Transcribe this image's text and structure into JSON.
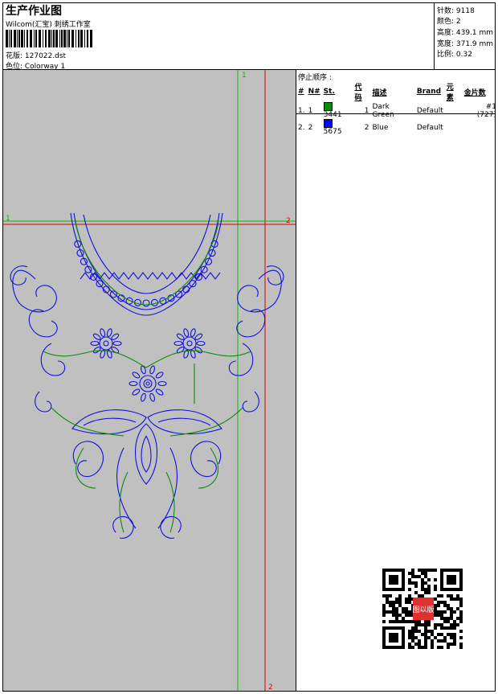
{
  "header": {
    "title": "生产作业图",
    "subtitle": "Wilcom(汇宝) 刺绣工作室",
    "file_label": "花版: 127022.dst",
    "colorway_label": "色位: Colorway 1"
  },
  "stats": [
    {
      "label": "针数: 9118"
    },
    {
      "label": "颜色: 2"
    },
    {
      "label": "高度: 439.1 mm"
    },
    {
      "label": "宽度: 371.9 mm"
    },
    {
      "label": "比例: 0.32"
    }
  ],
  "stop_sequence": {
    "title": "停止顺序 :",
    "headers": {
      "index": "#",
      "no": "N#",
      "st": "St.",
      "code": "代码",
      "desc": "描述",
      "brand": "Brand",
      "elem": "元素",
      "sequin": "金片数"
    },
    "rows": [
      {
        "index": "1.",
        "no": "1",
        "color": "#0a8a0a",
        "st": "3441",
        "code": "1",
        "desc": "Dark Green",
        "brand": "Default",
        "elem": "",
        "sequin": "#1 (727)"
      },
      {
        "index": "2.",
        "no": "2",
        "color": "#0000ff",
        "st": "5675",
        "code": "2",
        "desc": "Blue",
        "brand": "Default",
        "elem": "",
        "sequin": ""
      }
    ]
  },
  "guides": {
    "green_label": "1",
    "red_label": "2",
    "green_h_label": "1",
    "red_h_label": "2",
    "green_color": "#00c000",
    "red_color": "#e00000"
  },
  "qr": {
    "stamp_text": "图以版"
  }
}
